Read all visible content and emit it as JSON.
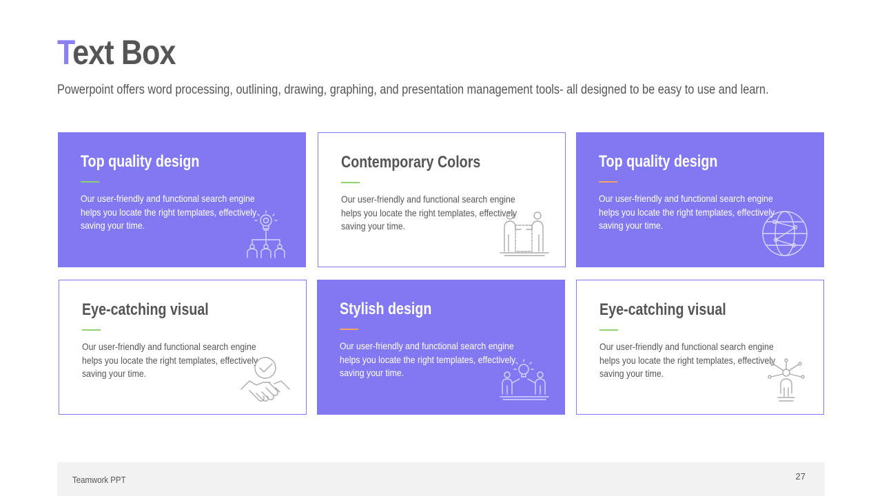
{
  "title": {
    "first_letter": "T",
    "rest": "ext Box"
  },
  "subtitle": "Powerpoint offers word processing, outlining, drawing, graphing, and presentation management tools- all designed to be easy to use and learn.",
  "colors": {
    "accent": "#8279f2",
    "title_first_letter": "#8b80f2",
    "text": "#555555",
    "footer_bg": "#f2f2f2"
  },
  "cards": [
    {
      "title": "Top quality design",
      "description": "Our user-friendly and functional search engine helps you locate the right templates, effectively saving your time.",
      "style": "filled",
      "line_color": "#8fd16a",
      "icon": "lightbulb-team-icon"
    },
    {
      "title": "Contemporary Colors",
      "description": "Our user-friendly and functional search engine helps you locate the right templates, effectively saving your time.",
      "style": "outline",
      "line_color": "#8fd16a",
      "icon": "partners-icon"
    },
    {
      "title": "Top quality design",
      "description": "Our user-friendly and functional search engine helps you locate the right templates, effectively saving your time.",
      "style": "filled",
      "line_color": "#f4a261",
      "icon": "globe-network-icon"
    },
    {
      "title": "Eye-catching visual",
      "description": "Our user-friendly and functional search engine helps you locate the right templates, effectively saving your time.",
      "style": "outline",
      "line_color": "#8fd16a",
      "icon": "handshake-check-icon"
    },
    {
      "title": "Stylish design",
      "description": "Our user-friendly and functional search engine helps you locate the right templates, effectively saving your time.",
      "style": "filled",
      "line_color": "#f4a261",
      "icon": "team-idea-icon"
    },
    {
      "title": "Eye-catching visual",
      "description": "Our user-friendly and functional search engine helps you locate the right templates, effectively saving your time.",
      "style": "outline",
      "line_color": "#8fd16a",
      "icon": "person-network-icon"
    }
  ],
  "footer": {
    "label": "Teamwork PPT",
    "page_number": "27"
  }
}
